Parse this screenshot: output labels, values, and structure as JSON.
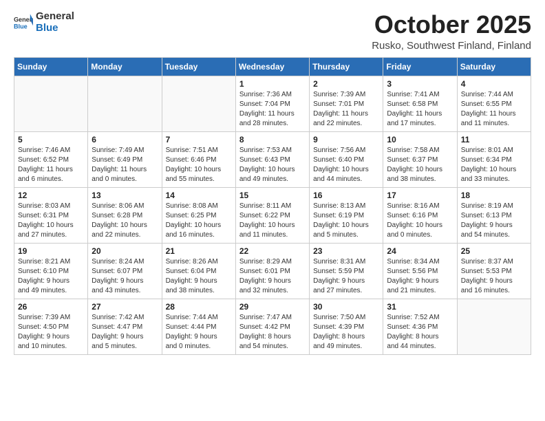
{
  "header": {
    "logo_general": "General",
    "logo_blue": "Blue",
    "month_title": "October 2025",
    "location": "Rusko, Southwest Finland, Finland"
  },
  "days_of_week": [
    "Sunday",
    "Monday",
    "Tuesday",
    "Wednesday",
    "Thursday",
    "Friday",
    "Saturday"
  ],
  "weeks": [
    [
      {
        "day": "",
        "info": ""
      },
      {
        "day": "",
        "info": ""
      },
      {
        "day": "",
        "info": ""
      },
      {
        "day": "1",
        "info": "Sunrise: 7:36 AM\nSunset: 7:04 PM\nDaylight: 11 hours\nand 28 minutes."
      },
      {
        "day": "2",
        "info": "Sunrise: 7:39 AM\nSunset: 7:01 PM\nDaylight: 11 hours\nand 22 minutes."
      },
      {
        "day": "3",
        "info": "Sunrise: 7:41 AM\nSunset: 6:58 PM\nDaylight: 11 hours\nand 17 minutes."
      },
      {
        "day": "4",
        "info": "Sunrise: 7:44 AM\nSunset: 6:55 PM\nDaylight: 11 hours\nand 11 minutes."
      }
    ],
    [
      {
        "day": "5",
        "info": "Sunrise: 7:46 AM\nSunset: 6:52 PM\nDaylight: 11 hours\nand 6 minutes."
      },
      {
        "day": "6",
        "info": "Sunrise: 7:49 AM\nSunset: 6:49 PM\nDaylight: 11 hours\nand 0 minutes."
      },
      {
        "day": "7",
        "info": "Sunrise: 7:51 AM\nSunset: 6:46 PM\nDaylight: 10 hours\nand 55 minutes."
      },
      {
        "day": "8",
        "info": "Sunrise: 7:53 AM\nSunset: 6:43 PM\nDaylight: 10 hours\nand 49 minutes."
      },
      {
        "day": "9",
        "info": "Sunrise: 7:56 AM\nSunset: 6:40 PM\nDaylight: 10 hours\nand 44 minutes."
      },
      {
        "day": "10",
        "info": "Sunrise: 7:58 AM\nSunset: 6:37 PM\nDaylight: 10 hours\nand 38 minutes."
      },
      {
        "day": "11",
        "info": "Sunrise: 8:01 AM\nSunset: 6:34 PM\nDaylight: 10 hours\nand 33 minutes."
      }
    ],
    [
      {
        "day": "12",
        "info": "Sunrise: 8:03 AM\nSunset: 6:31 PM\nDaylight: 10 hours\nand 27 minutes."
      },
      {
        "day": "13",
        "info": "Sunrise: 8:06 AM\nSunset: 6:28 PM\nDaylight: 10 hours\nand 22 minutes."
      },
      {
        "day": "14",
        "info": "Sunrise: 8:08 AM\nSunset: 6:25 PM\nDaylight: 10 hours\nand 16 minutes."
      },
      {
        "day": "15",
        "info": "Sunrise: 8:11 AM\nSunset: 6:22 PM\nDaylight: 10 hours\nand 11 minutes."
      },
      {
        "day": "16",
        "info": "Sunrise: 8:13 AM\nSunset: 6:19 PM\nDaylight: 10 hours\nand 5 minutes."
      },
      {
        "day": "17",
        "info": "Sunrise: 8:16 AM\nSunset: 6:16 PM\nDaylight: 10 hours\nand 0 minutes."
      },
      {
        "day": "18",
        "info": "Sunrise: 8:19 AM\nSunset: 6:13 PM\nDaylight: 9 hours\nand 54 minutes."
      }
    ],
    [
      {
        "day": "19",
        "info": "Sunrise: 8:21 AM\nSunset: 6:10 PM\nDaylight: 9 hours\nand 49 minutes."
      },
      {
        "day": "20",
        "info": "Sunrise: 8:24 AM\nSunset: 6:07 PM\nDaylight: 9 hours\nand 43 minutes."
      },
      {
        "day": "21",
        "info": "Sunrise: 8:26 AM\nSunset: 6:04 PM\nDaylight: 9 hours\nand 38 minutes."
      },
      {
        "day": "22",
        "info": "Sunrise: 8:29 AM\nSunset: 6:01 PM\nDaylight: 9 hours\nand 32 minutes."
      },
      {
        "day": "23",
        "info": "Sunrise: 8:31 AM\nSunset: 5:59 PM\nDaylight: 9 hours\nand 27 minutes."
      },
      {
        "day": "24",
        "info": "Sunrise: 8:34 AM\nSunset: 5:56 PM\nDaylight: 9 hours\nand 21 minutes."
      },
      {
        "day": "25",
        "info": "Sunrise: 8:37 AM\nSunset: 5:53 PM\nDaylight: 9 hours\nand 16 minutes."
      }
    ],
    [
      {
        "day": "26",
        "info": "Sunrise: 7:39 AM\nSunset: 4:50 PM\nDaylight: 9 hours\nand 10 minutes."
      },
      {
        "day": "27",
        "info": "Sunrise: 7:42 AM\nSunset: 4:47 PM\nDaylight: 9 hours\nand 5 minutes."
      },
      {
        "day": "28",
        "info": "Sunrise: 7:44 AM\nSunset: 4:44 PM\nDaylight: 9 hours\nand 0 minutes."
      },
      {
        "day": "29",
        "info": "Sunrise: 7:47 AM\nSunset: 4:42 PM\nDaylight: 8 hours\nand 54 minutes."
      },
      {
        "day": "30",
        "info": "Sunrise: 7:50 AM\nSunset: 4:39 PM\nDaylight: 8 hours\nand 49 minutes."
      },
      {
        "day": "31",
        "info": "Sunrise: 7:52 AM\nSunset: 4:36 PM\nDaylight: 8 hours\nand 44 minutes."
      },
      {
        "day": "",
        "info": ""
      }
    ]
  ]
}
